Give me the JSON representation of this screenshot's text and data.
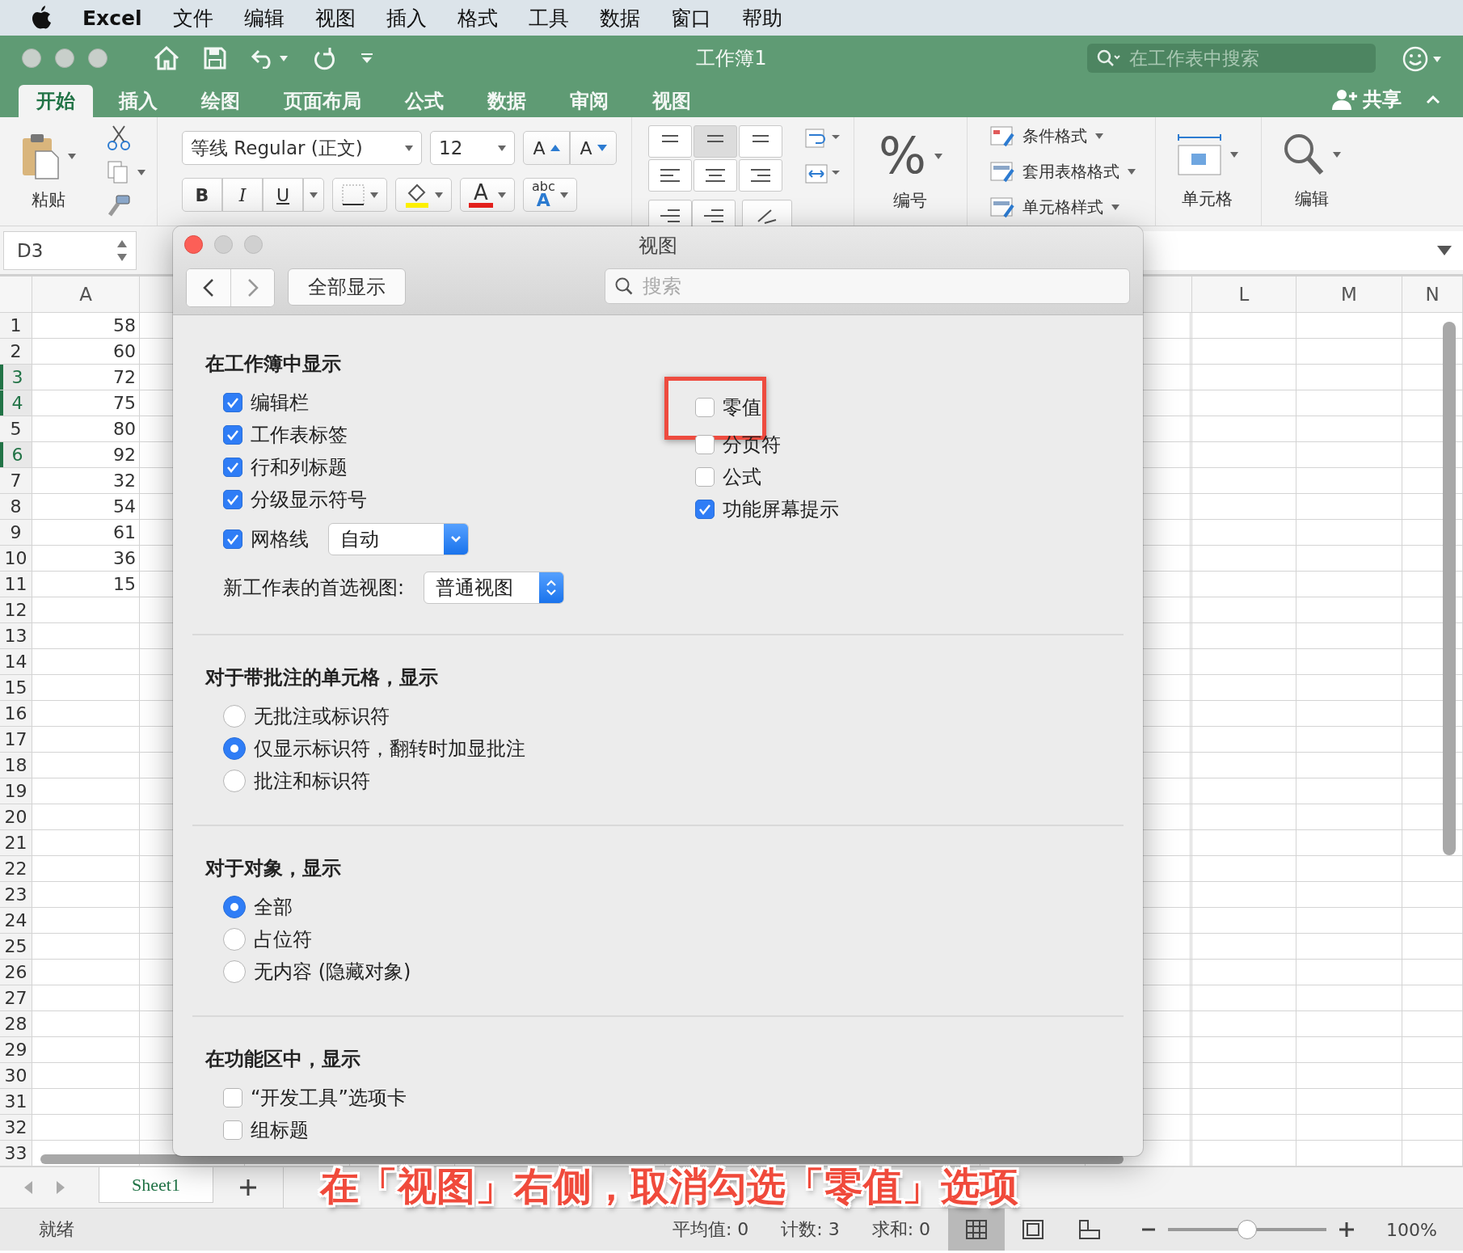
{
  "menu_bar": {
    "app": "Excel",
    "items": [
      "文件",
      "编辑",
      "视图",
      "插入",
      "格式",
      "工具",
      "数据",
      "窗口",
      "帮助"
    ]
  },
  "title_bar": {
    "title": "工作簿1",
    "search": {
      "placeholder": "在工作表中搜索"
    }
  },
  "ribbon_tabs": [
    {
      "label": "开始",
      "selected": true
    },
    {
      "label": "插入",
      "selected": false
    },
    {
      "label": "绘图",
      "selected": false
    },
    {
      "label": "页面布局",
      "selected": false
    },
    {
      "label": "公式",
      "selected": false
    },
    {
      "label": "数据",
      "selected": false
    },
    {
      "label": "审阅",
      "selected": false
    },
    {
      "label": "视图",
      "selected": false
    }
  ],
  "share": "共享",
  "ribbon": {
    "paste": "粘贴",
    "font_name": "等线 Regular (正文)",
    "font_size": "12",
    "grow_font": "A",
    "shrink_font": "A",
    "bold": "B",
    "italic": "I",
    "underline": "U",
    "font_color": "A",
    "phonetic_top": "abc",
    "phonetic_bottom": "A",
    "number_symbol": "%",
    "number": "编号",
    "styles": [
      "条件格式",
      "套用表格格式",
      "单元格样式"
    ],
    "cells": "单元格",
    "editing": "编辑"
  },
  "formula_bar": {
    "name_box": "D3"
  },
  "sheet": {
    "column_a": "A",
    "right_columns": [
      "L",
      "M",
      "N"
    ],
    "rows": [
      {
        "number": "1",
        "value": "58",
        "selected": false
      },
      {
        "number": "2",
        "value": "60",
        "selected": false
      },
      {
        "number": "3",
        "value": "72",
        "selected": true
      },
      {
        "number": "4",
        "value": "75",
        "selected": true
      },
      {
        "number": "5",
        "value": "80",
        "selected": false
      },
      {
        "number": "6",
        "value": "92",
        "selected": true
      },
      {
        "number": "7",
        "value": "32",
        "selected": false
      },
      {
        "number": "8",
        "value": "54",
        "selected": false
      },
      {
        "number": "9",
        "value": "61",
        "selected": false
      },
      {
        "number": "10",
        "value": "36",
        "selected": false
      },
      {
        "number": "11",
        "value": "15",
        "selected": false
      },
      {
        "number": "12",
        "selected": false
      },
      {
        "number": "13",
        "selected": false
      },
      {
        "number": "14",
        "selected": false
      },
      {
        "number": "15",
        "selected": false
      },
      {
        "number": "16",
        "selected": false
      },
      {
        "number": "17",
        "selected": false
      },
      {
        "number": "18",
        "selected": false
      },
      {
        "number": "19",
        "selected": false
      },
      {
        "number": "20",
        "selected": false
      },
      {
        "number": "21",
        "selected": false
      },
      {
        "number": "22",
        "selected": false
      },
      {
        "number": "23",
        "selected": false
      },
      {
        "number": "24",
        "selected": false
      },
      {
        "number": "25",
        "selected": false
      },
      {
        "number": "26",
        "selected": false
      },
      {
        "number": "27",
        "selected": false
      },
      {
        "number": "28",
        "selected": false
      },
      {
        "number": "29",
        "selected": false
      },
      {
        "number": "30",
        "selected": false
      },
      {
        "number": "31",
        "selected": false
      },
      {
        "number": "32",
        "selected": false
      },
      {
        "number": "33",
        "selected": false
      }
    ]
  },
  "sheet_tabs": [
    {
      "label": "Sheet1",
      "selected": true
    }
  ],
  "status_bar": {
    "status": "就绪",
    "average": "平均值: 0",
    "count": "计数: 3",
    "sum": "求和: 0",
    "views": [
      {
        "kind": "normal",
        "selected": true
      },
      {
        "kind": "page_layout",
        "selected": false
      },
      {
        "kind": "page_break",
        "selected": false
      }
    ],
    "zoom": {
      "level": 0.5,
      "reading": "100%"
    }
  },
  "dialog": {
    "title": "视图",
    "show_all": "全部显示",
    "search_placeholder": "搜索",
    "sections": [
      {
        "kind": "workbook",
        "heading": "在工作簿中显示",
        "left": [
          {
            "label": "编辑栏",
            "checked": true
          },
          {
            "label": "工作表标签",
            "checked": true
          },
          {
            "label": "行和列标题",
            "checked": true
          },
          {
            "label": "分级显示符号",
            "checked": true
          },
          {
            "label": "网格线",
            "checked": true,
            "dropdown": "自动"
          }
        ],
        "right": [
          {
            "label": "零值",
            "checked": false,
            "highlighted": true
          },
          {
            "label": "分页符",
            "checked": false,
            "highlighted": false
          },
          {
            "label": "公式",
            "checked": false,
            "highlighted": false
          },
          {
            "label": "功能屏幕提示",
            "checked": true,
            "highlighted": false
          }
        ],
        "preferred_view": {
          "label": "新工作表的首选视图:",
          "value": "普通视图"
        }
      },
      {
        "kind": "radios",
        "heading": "对于带批注的单元格，显示",
        "options": [
          {
            "label": "无批注或标识符",
            "selected": false
          },
          {
            "label": "仅显示标识符，翻转时加显批注",
            "selected": true
          },
          {
            "label": "批注和标识符",
            "selected": false
          }
        ]
      },
      {
        "kind": "radios",
        "heading": "对于对象，显示",
        "options": [
          {
            "label": "全部",
            "selected": true
          },
          {
            "label": "占位符",
            "selected": false
          },
          {
            "label": "无内容 (隐藏对象)",
            "selected": false
          }
        ]
      },
      {
        "kind": "checks",
        "heading": "在功能区中，显示",
        "options": [
          {
            "label": "“开发工具”选项卡",
            "checked": false
          },
          {
            "label": "组标题",
            "checked": false
          }
        ]
      }
    ]
  },
  "caption": "在「视图」右侧，取消勾选「零值」选项"
}
